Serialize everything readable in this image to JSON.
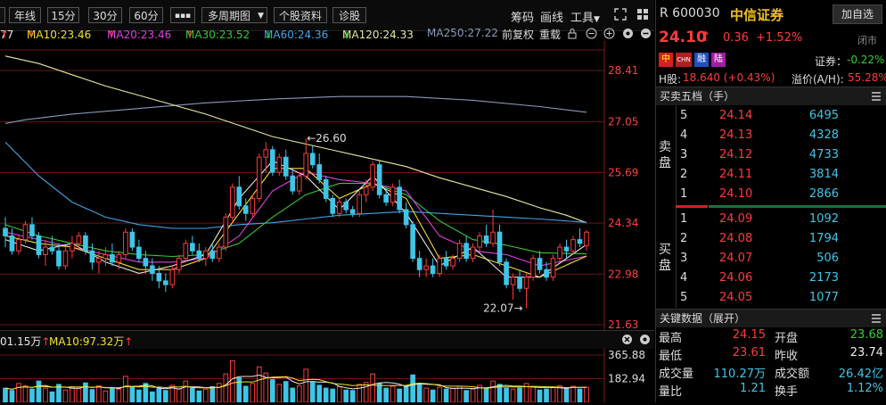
{
  "toolbar": {
    "timeframes": [
      "年线",
      "15分",
      "30分",
      "60分"
    ],
    "more": "▪▪▪",
    "multi_period": "多周期图",
    "stock_info": "个股资料",
    "diagnose": "诊股",
    "chips": "筹码",
    "draw": "画线",
    "tools": "工具"
  },
  "ma_line": {
    "ma5": "77",
    "ma10": "MA10:23.46",
    "ma20": "MA20:23.46",
    "ma30": "MA30:23.52",
    "ma60": "MA60:24.36",
    "ma120": "MA120:24.33",
    "ma250": "MA250:27.22",
    "adj": "前复权",
    "reset": "重载"
  },
  "chart_data": {
    "type": "candlestick",
    "y_ticks": [
      "28.41",
      "27.05",
      "25.69",
      "24.34",
      "22.98",
      "21.63"
    ],
    "ylim": [
      21.63,
      29.2
    ],
    "annotations": [
      {
        "text": "←26.60",
        "value": 26.6
      },
      {
        "text": "22.07→",
        "value": 22.07
      }
    ],
    "candles": [
      [
        24.2,
        24.5,
        23.7,
        24.0
      ],
      [
        24.0,
        24.2,
        23.5,
        23.6
      ],
      [
        23.6,
        24.0,
        23.5,
        23.9
      ],
      [
        23.9,
        24.4,
        23.8,
        24.3
      ],
      [
        24.3,
        24.5,
        23.9,
        24.0
      ],
      [
        24.0,
        24.1,
        23.4,
        23.5
      ],
      [
        23.5,
        23.9,
        23.2,
        23.7
      ],
      [
        23.7,
        24.0,
        23.5,
        23.6
      ],
      [
        23.6,
        23.8,
        23.1,
        23.2
      ],
      [
        23.2,
        23.7,
        23.1,
        23.6
      ],
      [
        23.6,
        24.0,
        23.4,
        23.8
      ],
      [
        23.8,
        24.1,
        23.7,
        24.0
      ],
      [
        24.0,
        24.1,
        23.5,
        23.6
      ],
      [
        23.6,
        23.8,
        23.1,
        23.3
      ],
      [
        23.3,
        23.6,
        23.0,
        23.4
      ],
      [
        23.4,
        23.7,
        23.2,
        23.5
      ],
      [
        23.5,
        23.8,
        23.2,
        23.3
      ],
      [
        23.3,
        23.6,
        23.1,
        23.5
      ],
      [
        23.5,
        24.2,
        23.4,
        24.1
      ],
      [
        24.1,
        24.2,
        23.6,
        23.7
      ],
      [
        23.7,
        23.9,
        23.3,
        23.4
      ],
      [
        23.4,
        23.6,
        23.0,
        23.2
      ],
      [
        23.2,
        23.4,
        22.8,
        23.0
      ],
      [
        23.0,
        23.2,
        22.6,
        22.8
      ],
      [
        22.8,
        23.0,
        22.5,
        22.7
      ],
      [
        22.7,
        23.2,
        22.6,
        23.1
      ],
      [
        23.1,
        23.5,
        23.0,
        23.4
      ],
      [
        23.4,
        23.9,
        23.3,
        23.8
      ],
      [
        23.8,
        24.0,
        23.5,
        23.6
      ],
      [
        23.6,
        23.8,
        23.3,
        23.4
      ],
      [
        23.4,
        23.7,
        23.2,
        23.6
      ],
      [
        23.6,
        23.8,
        23.3,
        23.4
      ],
      [
        23.4,
        23.8,
        23.3,
        23.7
      ],
      [
        23.7,
        24.6,
        23.6,
        24.5
      ],
      [
        24.5,
        25.4,
        24.4,
        25.3
      ],
      [
        25.3,
        25.6,
        24.7,
        24.8
      ],
      [
        24.8,
        25.0,
        24.4,
        24.6
      ],
      [
        24.6,
        25.1,
        24.5,
        25.0
      ],
      [
        25.0,
        26.2,
        24.9,
        26.1
      ],
      [
        26.1,
        26.5,
        25.7,
        26.3
      ],
      [
        26.3,
        26.4,
        25.6,
        25.7
      ],
      [
        25.7,
        26.2,
        25.6,
        26.1
      ],
      [
        26.1,
        26.3,
        25.5,
        25.6
      ],
      [
        25.6,
        25.8,
        25.1,
        25.2
      ],
      [
        25.2,
        25.7,
        25.1,
        25.6
      ],
      [
        25.6,
        26.6,
        25.5,
        26.2
      ],
      [
        26.2,
        26.4,
        25.8,
        25.9
      ],
      [
        25.9,
        26.2,
        25.4,
        25.5
      ],
      [
        25.5,
        25.6,
        24.9,
        25.0
      ],
      [
        25.0,
        25.1,
        24.5,
        24.6
      ],
      [
        24.6,
        25.0,
        24.5,
        24.9
      ],
      [
        24.9,
        25.0,
        24.6,
        24.7
      ],
      [
        24.7,
        24.8,
        24.5,
        24.6
      ],
      [
        24.6,
        25.2,
        24.5,
        25.1
      ],
      [
        25.1,
        25.5,
        24.9,
        25.3
      ],
      [
        25.3,
        26.0,
        25.2,
        25.9
      ],
      [
        25.9,
        26.0,
        25.0,
        25.1
      ],
      [
        25.1,
        25.3,
        24.8,
        24.9
      ],
      [
        24.9,
        25.4,
        24.8,
        25.3
      ],
      [
        25.3,
        25.5,
        24.6,
        24.7
      ],
      [
        24.7,
        24.9,
        24.2,
        24.3
      ],
      [
        24.3,
        24.4,
        23.3,
        23.4
      ],
      [
        23.4,
        23.6,
        22.9,
        23.1
      ],
      [
        23.1,
        23.4,
        22.9,
        23.2
      ],
      [
        23.2,
        23.4,
        22.9,
        23.0
      ],
      [
        23.0,
        23.5,
        22.9,
        23.4
      ],
      [
        23.4,
        23.6,
        23.1,
        23.2
      ],
      [
        23.2,
        23.5,
        23.1,
        23.4
      ],
      [
        23.4,
        23.9,
        23.3,
        23.8
      ],
      [
        23.8,
        24.0,
        23.3,
        23.4
      ],
      [
        23.4,
        23.8,
        23.3,
        23.7
      ],
      [
        23.7,
        24.1,
        23.6,
        24.0
      ],
      [
        24.0,
        24.3,
        23.7,
        23.8
      ],
      [
        23.8,
        24.7,
        23.7,
        24.1
      ],
      [
        24.1,
        24.3,
        23.2,
        23.3
      ],
      [
        23.3,
        23.4,
        22.6,
        22.7
      ],
      [
        22.7,
        23.0,
        22.3,
        22.9
      ],
      [
        22.9,
        23.1,
        22.5,
        22.6
      ],
      [
        22.6,
        23.0,
        22.07,
        22.9
      ],
      [
        22.9,
        23.5,
        22.8,
        23.4
      ],
      [
        23.4,
        23.6,
        23.0,
        23.1
      ],
      [
        23.1,
        23.3,
        22.8,
        22.9
      ],
      [
        22.9,
        23.5,
        22.8,
        23.4
      ],
      [
        23.4,
        23.8,
        23.3,
        23.7
      ],
      [
        23.7,
        23.9,
        23.4,
        23.6
      ],
      [
        23.6,
        24.0,
        23.5,
        23.9
      ],
      [
        23.9,
        24.2,
        23.7,
        23.8
      ],
      [
        23.74,
        24.15,
        23.61,
        24.1
      ]
    ],
    "ma250": [
      [
        0,
        27.0
      ],
      [
        3,
        27.1
      ],
      [
        10,
        27.25
      ],
      [
        20,
        27.4
      ],
      [
        30,
        27.55
      ],
      [
        40,
        27.65
      ],
      [
        50,
        27.72
      ],
      [
        60,
        27.72
      ],
      [
        70,
        27.62
      ],
      [
        80,
        27.45
      ],
      [
        87,
        27.3
      ]
    ],
    "ma120": [
      [
        0,
        28.8
      ],
      [
        5,
        28.6
      ],
      [
        10,
        28.3
      ],
      [
        15,
        28.0
      ],
      [
        20,
        27.75
      ],
      [
        25,
        27.5
      ],
      [
        30,
        27.25
      ],
      [
        35,
        26.95
      ],
      [
        40,
        26.65
      ],
      [
        45,
        26.45
      ],
      [
        50,
        26.25
      ],
      [
        55,
        26.05
      ],
      [
        60,
        25.85
      ],
      [
        65,
        25.55
      ],
      [
        70,
        25.3
      ],
      [
        75,
        25.05
      ],
      [
        80,
        24.75
      ],
      [
        84,
        24.55
      ],
      [
        87,
        24.35
      ]
    ],
    "ma60": [
      [
        0,
        26.5
      ],
      [
        5,
        25.6
      ],
      [
        10,
        24.9
      ],
      [
        15,
        24.5
      ],
      [
        20,
        24.3
      ],
      [
        25,
        24.2
      ],
      [
        30,
        24.2
      ],
      [
        35,
        24.3
      ],
      [
        40,
        24.35
      ],
      [
        45,
        24.45
      ],
      [
        50,
        24.55
      ],
      [
        55,
        24.6
      ],
      [
        60,
        24.65
      ],
      [
        65,
        24.6
      ],
      [
        70,
        24.55
      ],
      [
        75,
        24.5
      ],
      [
        80,
        24.45
      ],
      [
        87,
        24.36
      ]
    ],
    "ma30": [
      [
        0,
        24.3
      ],
      [
        5,
        24.0
      ],
      [
        10,
        23.8
      ],
      [
        15,
        23.6
      ],
      [
        20,
        23.5
      ],
      [
        25,
        23.45
      ],
      [
        30,
        23.5
      ],
      [
        35,
        23.8
      ],
      [
        40,
        24.5
      ],
      [
        45,
        25.1
      ],
      [
        50,
        25.4
      ],
      [
        55,
        25.4
      ],
      [
        60,
        25.1
      ],
      [
        65,
        24.4
      ],
      [
        70,
        23.9
      ],
      [
        75,
        23.75
      ],
      [
        80,
        23.55
      ],
      [
        87,
        23.52
      ]
    ],
    "ma20": [
      [
        0,
        24.1
      ],
      [
        5,
        23.9
      ],
      [
        10,
        23.7
      ],
      [
        15,
        23.5
      ],
      [
        20,
        23.3
      ],
      [
        25,
        23.3
      ],
      [
        30,
        23.4
      ],
      [
        35,
        24.0
      ],
      [
        40,
        25.2
      ],
      [
        45,
        25.7
      ],
      [
        50,
        25.5
      ],
      [
        55,
        25.4
      ],
      [
        60,
        25.2
      ],
      [
        65,
        24.0
      ],
      [
        70,
        23.6
      ],
      [
        75,
        23.5
      ],
      [
        80,
        23.2
      ],
      [
        87,
        23.46
      ]
    ],
    "ma10": [
      [
        0,
        24.0
      ],
      [
        5,
        23.8
      ],
      [
        10,
        23.7
      ],
      [
        15,
        23.4
      ],
      [
        20,
        23.1
      ],
      [
        25,
        23.1
      ],
      [
        30,
        23.4
      ],
      [
        35,
        24.6
      ],
      [
        40,
        25.8
      ],
      [
        45,
        25.8
      ],
      [
        50,
        25.0
      ],
      [
        55,
        25.4
      ],
      [
        60,
        25.0
      ],
      [
        65,
        23.4
      ],
      [
        70,
        23.5
      ],
      [
        75,
        23.2
      ],
      [
        80,
        22.9
      ],
      [
        87,
        23.46
      ]
    ],
    "ma5": [
      [
        0,
        23.9
      ],
      [
        5,
        23.6
      ],
      [
        10,
        23.8
      ],
      [
        15,
        23.3
      ],
      [
        20,
        23.0
      ],
      [
        25,
        23.2
      ],
      [
        30,
        23.5
      ],
      [
        35,
        25.0
      ],
      [
        40,
        26.0
      ],
      [
        45,
        25.6
      ],
      [
        50,
        24.7
      ],
      [
        55,
        25.6
      ],
      [
        60,
        24.6
      ],
      [
        65,
        23.2
      ],
      [
        70,
        23.7
      ],
      [
        75,
        22.9
      ],
      [
        80,
        22.9
      ],
      [
        87,
        23.77
      ]
    ]
  },
  "volume": {
    "label1": "01.15万",
    "label2": "MA10:97.32万",
    "ticks": [
      "365.88",
      "182.94"
    ],
    "bars": [
      30,
      25,
      40,
      35,
      28,
      45,
      30,
      22,
      38,
      26,
      33,
      29,
      41,
      27,
      35,
      24,
      30,
      28,
      55,
      32,
      26,
      40,
      22,
      30,
      25,
      36,
      28,
      45,
      30,
      24,
      28,
      33,
      40,
      60,
      88,
      52,
      34,
      40,
      75,
      62,
      48,
      38,
      44,
      30,
      35,
      70,
      42,
      36,
      30,
      28,
      33,
      26,
      25,
      38,
      42,
      60,
      40,
      30,
      34,
      28,
      35,
      58,
      40,
      30,
      26,
      32,
      28,
      30,
      34,
      25,
      28,
      36,
      30,
      45,
      38,
      30,
      28,
      30,
      40,
      33,
      26,
      28,
      31,
      35,
      30,
      34,
      28,
      32
    ]
  },
  "quote": {
    "code": "R 600030",
    "name": "中信证券",
    "add_btn": "加自选",
    "price": "24.10",
    "change": "0.36",
    "change_pct": "+1.52%",
    "status": "闭市",
    "tags": [
      "中",
      "CHN",
      "融",
      "陆"
    ],
    "sector_label": "证券：",
    "sector_pct": "-0.22%",
    "hshare_label": "H股:",
    "hshare_value": "18.640 (+0.43%)",
    "premium_label": "溢价(A/H):",
    "premium_value": "55.28%"
  },
  "orderbook": {
    "title": "买卖五档（手）",
    "sell_label": "卖盘",
    "buy_label": "买盘",
    "asks": [
      {
        "lv": "5",
        "price": "24.14",
        "vol": "6495"
      },
      {
        "lv": "4",
        "price": "24.13",
        "vol": "4328"
      },
      {
        "lv": "3",
        "price": "24.12",
        "vol": "4733"
      },
      {
        "lv": "2",
        "price": "24.11",
        "vol": "3814"
      },
      {
        "lv": "1",
        "price": "24.10",
        "vol": "2866"
      }
    ],
    "bids": [
      {
        "lv": "1",
        "price": "24.09",
        "vol": "1092"
      },
      {
        "lv": "2",
        "price": "24.08",
        "vol": "1794"
      },
      {
        "lv": "3",
        "price": "24.07",
        "vol": "506"
      },
      {
        "lv": "4",
        "price": "24.06",
        "vol": "2173"
      },
      {
        "lv": "5",
        "price": "24.05",
        "vol": "1077"
      }
    ]
  },
  "key_data": {
    "title": "关键数据（展开）",
    "rows": [
      {
        "l1": "最高",
        "v1": "24.15",
        "l2": "开盘",
        "v2": "23.68"
      },
      {
        "l1": "最低",
        "v1": "23.61",
        "l2": "昨收",
        "v2": "23.74"
      },
      {
        "l1": "成交量",
        "v1": "110.27万",
        "l2": "成交额",
        "v2": "26.42亿"
      },
      {
        "l1": "量比",
        "v1": "1.21",
        "l2": "换手",
        "v2": "1.12%"
      }
    ]
  },
  "colors": {
    "up": "#ff3b3b",
    "down": "#2ad22a",
    "cyan": "#3ec6e8",
    "ma5": "#e8e8e8",
    "ma10": "#f0e030",
    "ma20": "#e040e0",
    "ma30": "#38c838",
    "ma60": "#3ea6e8",
    "ma120": "#e8e8a0",
    "ma250": "#8a9ab8"
  }
}
